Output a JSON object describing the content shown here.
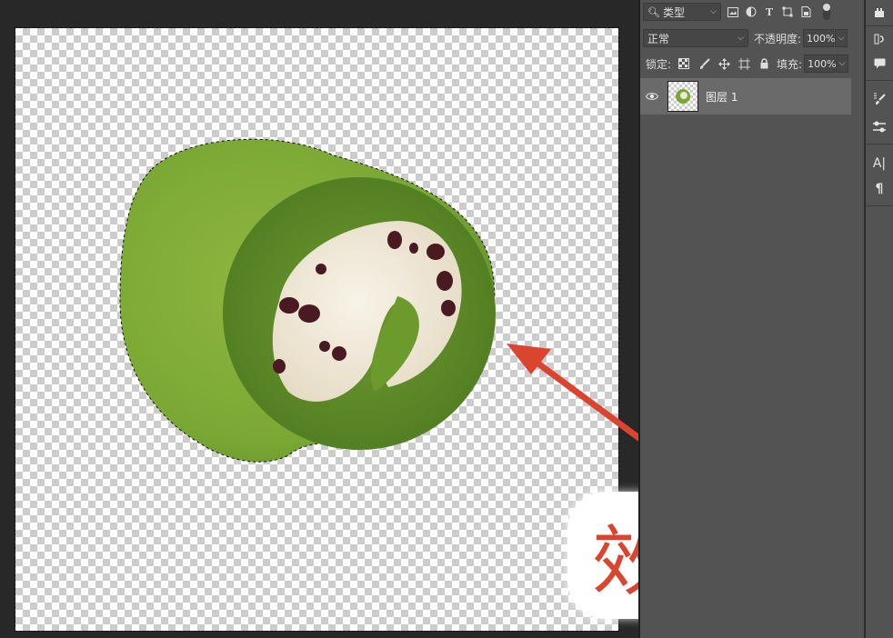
{
  "layers_panel": {
    "filter": {
      "kind_label": "类型",
      "kind_icon": "search-icon"
    },
    "filter_icons": [
      "image-filter-icon",
      "adjustment-filter-icon",
      "type-filter-icon",
      "shape-filter-icon",
      "smart-object-filter-icon"
    ],
    "blend_mode": "正常",
    "opacity_label": "不透明度:",
    "opacity_value": "100%",
    "lock_label": "锁定:",
    "fill_label": "填充:",
    "fill_value": "100%",
    "layers": [
      {
        "name": "图层 1",
        "visible": true
      }
    ]
  },
  "canvas": {
    "annotation_text": "效果图",
    "annotation_color": "#d9452f"
  },
  "right_toolbar": {
    "icons": [
      "history-icon",
      "comment-icon",
      "brush-settings-icon",
      "adjustments-icon",
      "character-icon",
      "paragraph-icon"
    ]
  }
}
